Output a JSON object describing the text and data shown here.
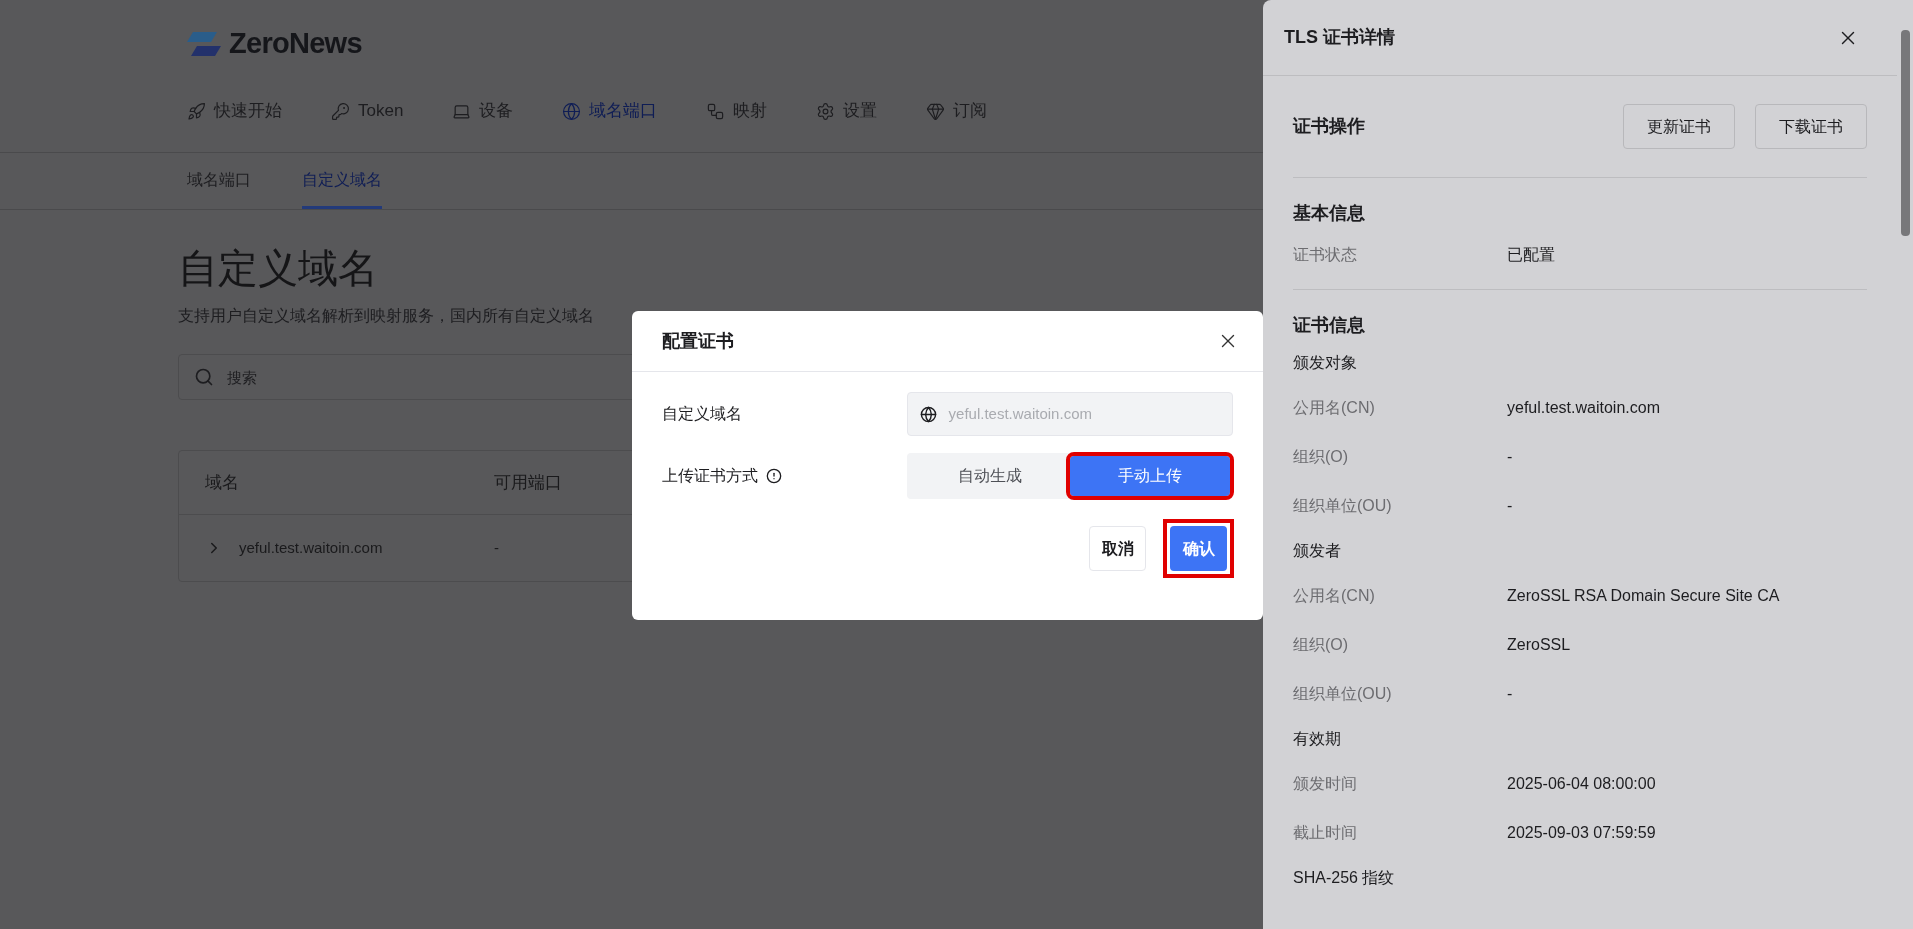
{
  "logo": {
    "text": "ZeroNews"
  },
  "nav": [
    {
      "label": "快速开始",
      "selected": false
    },
    {
      "label": "Token",
      "selected": false
    },
    {
      "label": "设备",
      "selected": false
    },
    {
      "label": "域名端口",
      "selected": true
    },
    {
      "label": "映射",
      "selected": false
    },
    {
      "label": "设置",
      "selected": false
    },
    {
      "label": "订阅",
      "selected": false
    }
  ],
  "subtabs": [
    {
      "label": "域名端口",
      "selected": false
    },
    {
      "label": "自定义域名",
      "selected": true
    }
  ],
  "page": {
    "title": "自定义域名",
    "description": "支持用户自定义域名解析到映射服务，国内所有自定义域名"
  },
  "search": {
    "placeholder": "搜索"
  },
  "table": {
    "columns": [
      "域名",
      "可用端口"
    ],
    "rows": [
      {
        "expanded": false,
        "domain": "yeful.test.waitoin.com",
        "ports": "-"
      }
    ]
  },
  "modal": {
    "title": "配置证书",
    "fields": [
      {
        "kind": "input",
        "label": "自定义域名",
        "value": "yeful.test.waitoin.com",
        "disabled": true
      },
      {
        "kind": "segmented",
        "label": "上传证书方式",
        "options": [
          {
            "label": "自动生成",
            "selected": false,
            "highlighted": false
          },
          {
            "label": "手动上传",
            "selected": true,
            "highlighted": true
          }
        ]
      }
    ],
    "buttons": [
      {
        "label": "取消",
        "primary": false,
        "highlighted": false
      },
      {
        "label": "确认",
        "primary": true,
        "highlighted": true
      }
    ]
  },
  "drawer": {
    "title": "TLS 证书详情",
    "actions_title": "证书操作",
    "actions": [
      "更新证书",
      "下载证书"
    ],
    "sections": [
      {
        "title": "基本信息",
        "items": [
          {
            "kind": "row",
            "label": "证书状态",
            "value": "已配置"
          }
        ]
      },
      {
        "title": "证书信息",
        "items": [
          {
            "kind": "subhead",
            "label": "颁发对象"
          },
          {
            "kind": "row",
            "label": "公用名(CN)",
            "value": "yeful.test.waitoin.com"
          },
          {
            "kind": "row",
            "label": "组织(O)",
            "value": "-"
          },
          {
            "kind": "row",
            "label": "组织单位(OU)",
            "value": "-"
          },
          {
            "kind": "subhead",
            "label": "颁发者"
          },
          {
            "kind": "row",
            "label": "公用名(CN)",
            "value": "ZeroSSL RSA Domain Secure Site CA"
          },
          {
            "kind": "row",
            "label": "组织(O)",
            "value": "ZeroSSL"
          },
          {
            "kind": "row",
            "label": "组织单位(OU)",
            "value": "-"
          },
          {
            "kind": "subhead",
            "label": "有效期"
          },
          {
            "kind": "row",
            "label": "颁发时间",
            "value": "2025-06-04 08:00:00"
          },
          {
            "kind": "row",
            "label": "截止时间",
            "value": "2025-09-03 07:59:59"
          },
          {
            "kind": "subhead",
            "label": "SHA-256 指纹"
          }
        ]
      }
    ]
  }
}
